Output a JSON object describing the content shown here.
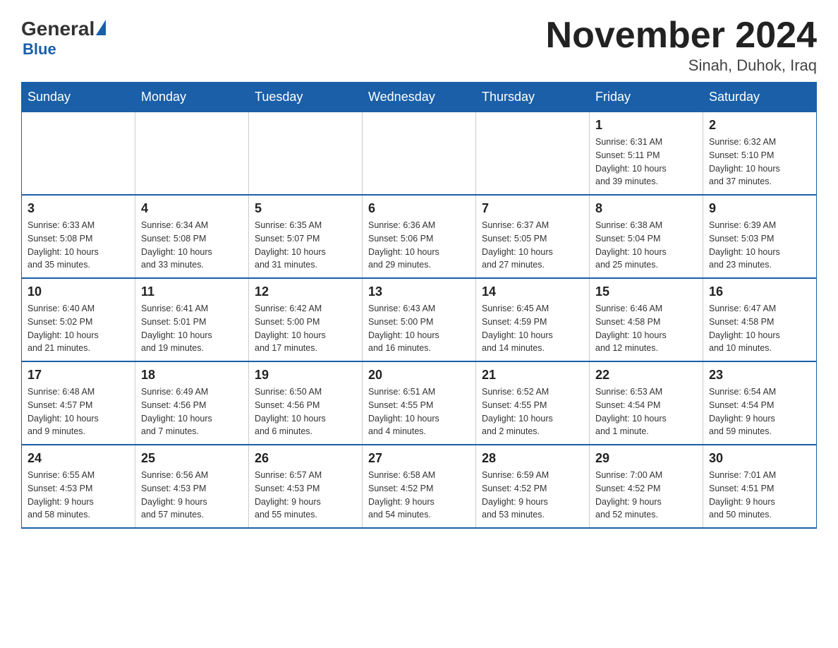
{
  "logo": {
    "general": "General",
    "blue": "Blue"
  },
  "header": {
    "title": "November 2024",
    "location": "Sinah, Duhok, Iraq"
  },
  "weekdays": [
    "Sunday",
    "Monday",
    "Tuesday",
    "Wednesday",
    "Thursday",
    "Friday",
    "Saturday"
  ],
  "weeks": [
    [
      {
        "day": "",
        "info": ""
      },
      {
        "day": "",
        "info": ""
      },
      {
        "day": "",
        "info": ""
      },
      {
        "day": "",
        "info": ""
      },
      {
        "day": "",
        "info": ""
      },
      {
        "day": "1",
        "info": "Sunrise: 6:31 AM\nSunset: 5:11 PM\nDaylight: 10 hours\nand 39 minutes."
      },
      {
        "day": "2",
        "info": "Sunrise: 6:32 AM\nSunset: 5:10 PM\nDaylight: 10 hours\nand 37 minutes."
      }
    ],
    [
      {
        "day": "3",
        "info": "Sunrise: 6:33 AM\nSunset: 5:08 PM\nDaylight: 10 hours\nand 35 minutes."
      },
      {
        "day": "4",
        "info": "Sunrise: 6:34 AM\nSunset: 5:08 PM\nDaylight: 10 hours\nand 33 minutes."
      },
      {
        "day": "5",
        "info": "Sunrise: 6:35 AM\nSunset: 5:07 PM\nDaylight: 10 hours\nand 31 minutes."
      },
      {
        "day": "6",
        "info": "Sunrise: 6:36 AM\nSunset: 5:06 PM\nDaylight: 10 hours\nand 29 minutes."
      },
      {
        "day": "7",
        "info": "Sunrise: 6:37 AM\nSunset: 5:05 PM\nDaylight: 10 hours\nand 27 minutes."
      },
      {
        "day": "8",
        "info": "Sunrise: 6:38 AM\nSunset: 5:04 PM\nDaylight: 10 hours\nand 25 minutes."
      },
      {
        "day": "9",
        "info": "Sunrise: 6:39 AM\nSunset: 5:03 PM\nDaylight: 10 hours\nand 23 minutes."
      }
    ],
    [
      {
        "day": "10",
        "info": "Sunrise: 6:40 AM\nSunset: 5:02 PM\nDaylight: 10 hours\nand 21 minutes."
      },
      {
        "day": "11",
        "info": "Sunrise: 6:41 AM\nSunset: 5:01 PM\nDaylight: 10 hours\nand 19 minutes."
      },
      {
        "day": "12",
        "info": "Sunrise: 6:42 AM\nSunset: 5:00 PM\nDaylight: 10 hours\nand 17 minutes."
      },
      {
        "day": "13",
        "info": "Sunrise: 6:43 AM\nSunset: 5:00 PM\nDaylight: 10 hours\nand 16 minutes."
      },
      {
        "day": "14",
        "info": "Sunrise: 6:45 AM\nSunset: 4:59 PM\nDaylight: 10 hours\nand 14 minutes."
      },
      {
        "day": "15",
        "info": "Sunrise: 6:46 AM\nSunset: 4:58 PM\nDaylight: 10 hours\nand 12 minutes."
      },
      {
        "day": "16",
        "info": "Sunrise: 6:47 AM\nSunset: 4:58 PM\nDaylight: 10 hours\nand 10 minutes."
      }
    ],
    [
      {
        "day": "17",
        "info": "Sunrise: 6:48 AM\nSunset: 4:57 PM\nDaylight: 10 hours\nand 9 minutes."
      },
      {
        "day": "18",
        "info": "Sunrise: 6:49 AM\nSunset: 4:56 PM\nDaylight: 10 hours\nand 7 minutes."
      },
      {
        "day": "19",
        "info": "Sunrise: 6:50 AM\nSunset: 4:56 PM\nDaylight: 10 hours\nand 6 minutes."
      },
      {
        "day": "20",
        "info": "Sunrise: 6:51 AM\nSunset: 4:55 PM\nDaylight: 10 hours\nand 4 minutes."
      },
      {
        "day": "21",
        "info": "Sunrise: 6:52 AM\nSunset: 4:55 PM\nDaylight: 10 hours\nand 2 minutes."
      },
      {
        "day": "22",
        "info": "Sunrise: 6:53 AM\nSunset: 4:54 PM\nDaylight: 10 hours\nand 1 minute."
      },
      {
        "day": "23",
        "info": "Sunrise: 6:54 AM\nSunset: 4:54 PM\nDaylight: 9 hours\nand 59 minutes."
      }
    ],
    [
      {
        "day": "24",
        "info": "Sunrise: 6:55 AM\nSunset: 4:53 PM\nDaylight: 9 hours\nand 58 minutes."
      },
      {
        "day": "25",
        "info": "Sunrise: 6:56 AM\nSunset: 4:53 PM\nDaylight: 9 hours\nand 57 minutes."
      },
      {
        "day": "26",
        "info": "Sunrise: 6:57 AM\nSunset: 4:53 PM\nDaylight: 9 hours\nand 55 minutes."
      },
      {
        "day": "27",
        "info": "Sunrise: 6:58 AM\nSunset: 4:52 PM\nDaylight: 9 hours\nand 54 minutes."
      },
      {
        "day": "28",
        "info": "Sunrise: 6:59 AM\nSunset: 4:52 PM\nDaylight: 9 hours\nand 53 minutes."
      },
      {
        "day": "29",
        "info": "Sunrise: 7:00 AM\nSunset: 4:52 PM\nDaylight: 9 hours\nand 52 minutes."
      },
      {
        "day": "30",
        "info": "Sunrise: 7:01 AM\nSunset: 4:51 PM\nDaylight: 9 hours\nand 50 minutes."
      }
    ]
  ]
}
